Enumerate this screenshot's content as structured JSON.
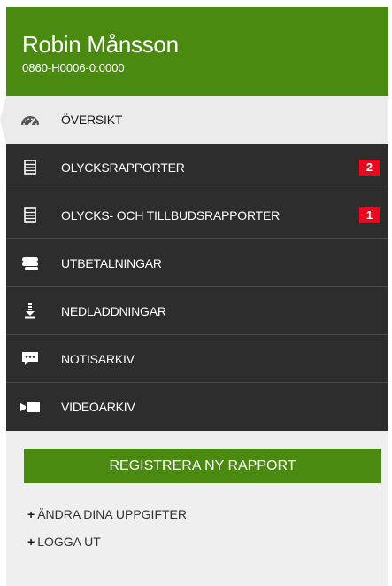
{
  "user": {
    "name": "Robin Månsson",
    "id": "0860-H0006-0:0000"
  },
  "nav": [
    {
      "label": "ÖVERSIKT",
      "icon": "speedometer-icon",
      "badge": ""
    },
    {
      "label": "OLYCKSRAPPORTER",
      "icon": "document-list-icon",
      "badge": "2"
    },
    {
      "label": "OLYCKS- OCH TILLBUDSRAPPORTER",
      "icon": "document-list-icon",
      "badge": "1"
    },
    {
      "label": "UTBETALNINGAR",
      "icon": "coins-icon",
      "badge": ""
    },
    {
      "label": "NEDLADDNINGAR",
      "icon": "download-icon",
      "badge": ""
    },
    {
      "label": "NOTISARKIV",
      "icon": "chat-icon",
      "badge": ""
    },
    {
      "label": "VIDEOARKIV",
      "icon": "video-camera-icon",
      "badge": ""
    }
  ],
  "register_button": "REGISTRERA NY RAPPORT",
  "links": [
    {
      "plus": "+",
      "label": "ÄNDRA DINA UPPGIFTER"
    },
    {
      "plus": "+",
      "label": "LOGGA UT"
    }
  ],
  "colors": {
    "brand_green": "#4b8a10",
    "nav_bg": "#2d2d2d",
    "badge_red": "#e8091e"
  }
}
